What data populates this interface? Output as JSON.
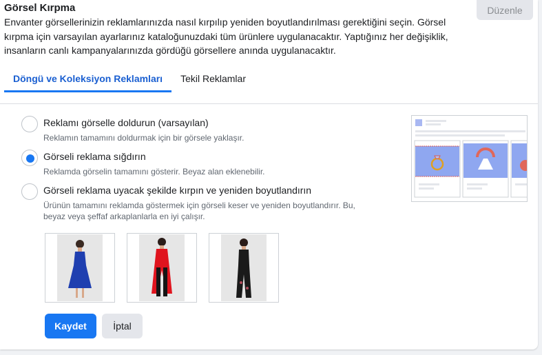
{
  "header": {
    "title": "Görsel Kırpma",
    "description": "Envanter görsellerinizin reklamlarınızda nasıl kırpılıp yeniden boyutlandırılması gerektiğini seçin. Görsel kırpma için varsayılan ayarlarınız kataloğunuzdaki tüm ürünlere uygulanacaktır. Yaptığınız her değişiklik, insanların canlı kampanyalarınızda gördüğü görsellere anında uygulanacaktır.",
    "edit_label": "Düzenle"
  },
  "tabs": [
    {
      "label": "Döngü ve Koleksiyon Reklamları",
      "active": true
    },
    {
      "label": "Tekil Reklamlar",
      "active": false
    }
  ],
  "options": [
    {
      "label": "Reklamı görselle doldurun (varsayılan)",
      "help": "Reklamın tamamını doldurmak için bir görsele yaklaşır.",
      "selected": false
    },
    {
      "label": "Görseli reklama sığdırın",
      "help": "Reklamda görselin tamamını gösterir. Beyaz alan eklenebilir.",
      "selected": true
    },
    {
      "label": "Görseli reklama uyacak şekilde kırpın ve yeniden boyutlandırın",
      "help": "Ürünün tamamını reklamda göstermek için görseli keser ve yeniden boyutlandırır. Bu, beyaz veya şeffaf arkaplanlarla en iyi çalışır.",
      "selected": false
    }
  ],
  "thumbnails": [
    {
      "name": "blue-dress",
      "color": "#1f3fb0"
    },
    {
      "name": "red-top-black-pants",
      "color": "#e0141e"
    },
    {
      "name": "black-outfit",
      "color": "#1a1a1a"
    }
  ],
  "actions": {
    "save_label": "Kaydet",
    "cancel_label": "İptal"
  },
  "colors": {
    "accent": "#1877f2",
    "preview_blue": "#8fa7f0",
    "preview_red": "#e0675a"
  }
}
